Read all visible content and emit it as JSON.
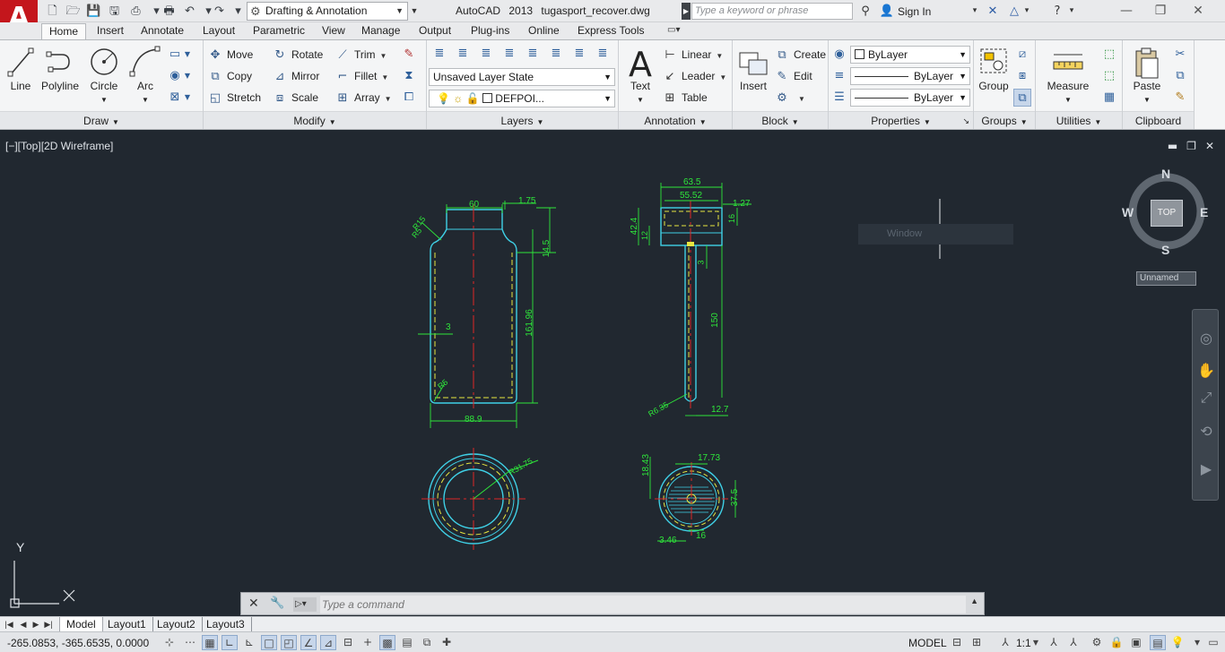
{
  "window": {
    "app_name": "AutoCAD 2013",
    "file_name": "tugasport_recover.dwg",
    "workspace": "Drafting & Annotation",
    "search_placeholder": "Type a keyword or phrase",
    "sign_in": "Sign In"
  },
  "ribbon_tabs": [
    "Home",
    "Insert",
    "Annotate",
    "Layout",
    "Parametric",
    "View",
    "Manage",
    "Output",
    "Plug-ins",
    "Online",
    "Express Tools"
  ],
  "active_tab": "Home",
  "panels": {
    "draw": {
      "title": "Draw",
      "line": "Line",
      "polyline": "Polyline",
      "circle": "Circle",
      "arc": "Arc"
    },
    "modify": {
      "title": "Modify",
      "move": "Move",
      "rotate": "Rotate",
      "trim": "Trim",
      "copy": "Copy",
      "mirror": "Mirror",
      "fillet": "Fillet",
      "stretch": "Stretch",
      "scale": "Scale",
      "array": "Array"
    },
    "layers": {
      "title": "Layers",
      "layer_state": "Unsaved Layer State",
      "current_layer": "DEFPOI..."
    },
    "annotation": {
      "title": "Annotation",
      "text": "Text",
      "linear": "Linear",
      "leader": "Leader",
      "table": "Table"
    },
    "block": {
      "title": "Block",
      "insert": "Insert",
      "create": "Create",
      "edit": "Edit"
    },
    "properties": {
      "title": "Properties",
      "color": "ByLayer",
      "linetype": "ByLayer",
      "lineweight": "ByLayer"
    },
    "groups": {
      "title": "Groups",
      "group": "Group"
    },
    "utilities": {
      "title": "Utilities",
      "measure": "Measure"
    },
    "clipboard": {
      "title": "Clipboard",
      "paste": "Paste"
    }
  },
  "viewport": {
    "label": "[−][Top][2D Wireframe]",
    "viewcube_face": "TOP",
    "compass": {
      "n": "N",
      "s": "S",
      "e": "E",
      "w": "W"
    },
    "wcs": "Unnamed",
    "tooltip": "Window"
  },
  "dimensions": {
    "front": [
      "60",
      "1.75",
      "R15",
      "R5",
      "14.5",
      "161.96",
      "3",
      "R5",
      "88.9"
    ],
    "side": [
      "63.5",
      "55.52",
      "1.27",
      "42.4",
      "12",
      "16",
      "3",
      "150",
      "R6.35",
      "12.7"
    ],
    "top_left": [
      "R31.75"
    ],
    "top_right": [
      "17.73",
      "18.43",
      "37.5",
      "3.46",
      "16"
    ]
  },
  "ucs": {
    "y": "Y"
  },
  "command": {
    "placeholder": "Type a command"
  },
  "layout_tabs": [
    "Model",
    "Layout1",
    "Layout2",
    "Layout3"
  ],
  "active_layout": "Model",
  "status": {
    "coords": "-265.0853, -365.6535, 0.0000",
    "space": "MODEL",
    "scale": "1:1"
  },
  "colors": {
    "accent_red": "#c4161c",
    "canvas": "#212830",
    "dimension": "#2ee63a",
    "object_cyan": "#3fd0e6",
    "hidden_yellow": "#e6e640",
    "center_red": "#e02626"
  }
}
